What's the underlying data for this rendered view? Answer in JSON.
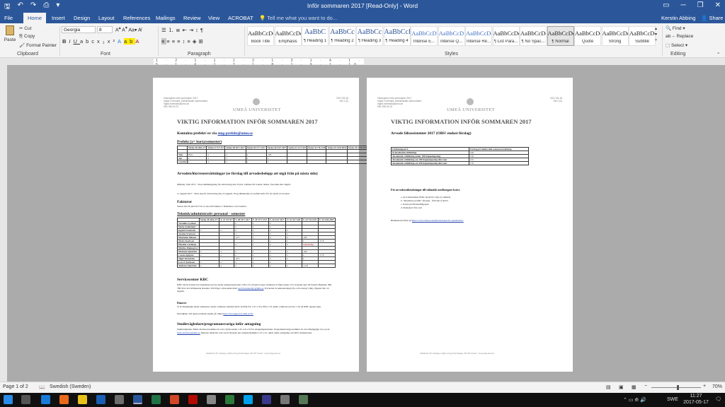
{
  "window": {
    "title": "Inför sommaren 2017 [Read-Only] - Word",
    "user": "Kerstin Abbing",
    "share": "Share"
  },
  "tabs": [
    "File",
    "Home",
    "Insert",
    "Design",
    "Layout",
    "References",
    "Mailings",
    "Review",
    "View",
    "ACROBAT"
  ],
  "tell_me": "Tell me what you want to do...",
  "clipboard": {
    "paste": "Paste",
    "cut": "Cut",
    "copy": "Copy",
    "format_painter": "Format Painter",
    "label": "Clipboard"
  },
  "font": {
    "name": "Georgia",
    "size": "8",
    "label": "Font"
  },
  "paragraph": {
    "label": "Paragraph"
  },
  "styles": {
    "label": "Styles",
    "items": [
      {
        "preview": "AaBbCcDd",
        "name": "Book Title"
      },
      {
        "preview": "AaBbCcDd",
        "name": "Emphasis"
      },
      {
        "preview": "AaBbC",
        "name": "¶ Heading 1"
      },
      {
        "preview": "AaBbCc",
        "name": "¶ Heading 2"
      },
      {
        "preview": "AaBbCc",
        "name": "¶ Heading 3"
      },
      {
        "preview": "AaBbCcD",
        "name": "¶ Heading 4"
      },
      {
        "preview": "AaBbCcD",
        "name": "Intense E..."
      },
      {
        "preview": "AaBbCcD",
        "name": "Intense Q..."
      },
      {
        "preview": "AaBbCcDd",
        "name": "Intense Re..."
      },
      {
        "preview": "AaBbCcDd",
        "name": "¶ List Para..."
      },
      {
        "preview": "AaBbCcDd",
        "name": "¶ No Spac..."
      },
      {
        "preview": "AaBbCcDd",
        "name": "¶ Normal"
      },
      {
        "preview": "AaBbCcDd",
        "name": "Quote"
      },
      {
        "preview": "AaBbCcDd",
        "name": "Strong"
      },
      {
        "preview": "AaBbCcDd",
        "name": "Subtitle"
      }
    ]
  },
  "editing": {
    "find": "Find",
    "replace": "Replace",
    "select": "Select",
    "label": "Editing"
  },
  "ruler_text": "1 · 2 · 1 · 1 · 1 · 2 · 1 · 3 · 1 · 4 · 1 · 5 · 1 · 6 · 1 · 7 · 1 · 8 · 1 · 9 · 1 · 10 · 1 · 11 · 1 · 12 · 1 · 13 · 1 · 14 · 1 · 15 · 1 · 16 · 17 · 18",
  "page1": {
    "hdr_left": "Information inför sommaren 2017\nIngrid Foremark, Administrativ samordnare\ningrid.foremark@umu.se\n090-786 63 22",
    "hdr_right": "2017-05-16\nSid 1 (2)",
    "uni": "UMEÅ UNIVERSITET",
    "title": "VIKTIG INFORMATION INFÖR SOMMAREN 2017",
    "contact": "Kontakta prefekt/-er via ",
    "contact_link": "emg-prefekt@umu.se",
    "prefekt_head": "Prefekt (x= borta/semester)",
    "prefekt_cols": [
      "",
      "Vecka 26 26/6-2/7",
      "Vecka 27 3/7-9/7",
      "Vecka 28 10/7-16/7",
      "Vecka 29 17/7-23/7",
      "Vecka 30 24/7-30/7",
      "Vecka 31 31/7-6/8",
      "Vecka 32 7/8-13/8",
      "Vecka 33 14/8-20/8",
      "Vecka 34 21/8-27/8",
      "Ytterligare ledighet"
    ],
    "prefekt_rows": [
      [
        "",
        "",
        "",
        "",
        "",
        "",
        "",
        "",
        "",
        "",
        "Vecka 23 lagförd"
      ],
      [
        "Tom",
        "29.6-",
        "x",
        "x",
        "x",
        "-4.8",
        "",
        "",
        "",
        "",
        "Vecka 25 lagförd"
      ],
      [
        "Jon",
        "x",
        "x",
        "x",
        "x",
        "x",
        "",
        "",
        "",
        "",
        "Vecka 35 lagförd"
      ],
      [
        "Carolin",
        "x",
        "x",
        "x",
        "x",
        "x",
        "",
        "",
        "",
        "",
        ""
      ]
    ],
    "arv_head": "Arvoden/lön/reseersättningar (se förslag till arvodesbelopp att utgå från på nästa sida)",
    "arv_p1": "Måndag 3 juli 2017 - Sista inlämningsdag för rubricering den 25 juli. Lämnas till Joanna, Marie, Veronika eller Ingrid.",
    "arv_p2": "11 augusti 2017 - Sista dag för rubricering den 25 augusti. Ett godkännande av prefekt krävs för att betala ut arvoden.",
    "fakt_head": "Fakturor",
    "fakt_p": "Senast den 30 juni 2017 kl 12 ska alla fakturor i Raindance vara betalda.",
    "tek_head": "Teknisk/administrativ personal - semester",
    "tek_cols": [
      "",
      "Vecka 26 26/6-2/7",
      "V. 27 3/7-9/7",
      "V. 28 10/7-16/7",
      "V. 29 17/7-23/7",
      "V. 30 24/7-30/7",
      "V. 31 31/7-6/8",
      "V. 32 7/8-13/8",
      "V. 33 14/8-20/8"
    ],
    "tek_rows": [
      [
        "Veronika Lyskaer",
        "",
        "",
        "x",
        "x",
        "x",
        "",
        "",
        ""
      ],
      [
        "Marie Söderlund",
        "",
        "",
        "x",
        "x",
        "x",
        "",
        "",
        ""
      ],
      [
        "Ingrid Foremark",
        "x",
        "x",
        "x",
        "x",
        "x",
        "x",
        "",
        ""
      ],
      [
        "Joanna Svensson",
        "",
        "",
        "x",
        "x",
        "x",
        "x",
        "",
        ""
      ],
      [
        "Marianne Nilsson",
        "",
        "",
        "12.7-",
        "x",
        "x",
        "x",
        "-4.8",
        ""
      ],
      [
        "Maria Karlsson",
        "",
        "",
        "",
        "x",
        "x",
        "x",
        "x",
        "-15.8"
      ],
      [
        "Elisabet Carlberg",
        "",
        "",
        "x",
        "x",
        "x",
        "x",
        "Tjänstledig",
        ""
      ],
      [
        "Märtha Malmqvist",
        "",
        "",
        "",
        "",
        "",
        "",
        "",
        ""
      ],
      [
        "Mariana Sjöström",
        "x",
        "x",
        "x",
        "x",
        "x",
        "x",
        "-4.8",
        ""
      ],
      [
        "Carola Sjögren",
        "x",
        "x",
        "x",
        "x",
        "x",
        "x",
        "x",
        "-17.8"
      ],
      [
        "Tegel Jernström",
        "",
        "",
        "10.7-",
        "x",
        "x",
        "x",
        "x",
        ""
      ],
      [
        "Lars E Karlsson",
        "x",
        "x",
        "x",
        "x",
        "x",
        "",
        "",
        ""
      ],
      [
        "Andreas Sjöström",
        "x",
        "x",
        "x",
        "x",
        "x",
        "x",
        "-11.8",
        ""
      ]
    ],
    "kbc_head": "Servicecenter KBC",
    "kbc_p": "KBC-Servicecenter har begränsad service under semesterperioden v.28-v.31 (10 juli-6 aug). Ordinarie öl finns under v.25. Kontakt sker till Sandra Hedlund, 090-786 5614 vid brådskande ärenden. Vid frågor om kontakt mail:",
    "kbc_link": "servicecenter.kbc@umu.se",
    "kbc_p2": "Tryckeriet är semesterstängt (Ss och torsdag 5 juli). Öppnar åter 14 augusti.",
    "dat_head": "Datorer",
    "dat_p": "Vi är tillgängliga under semestern, under ordinarie arbetstid (kl 8-16 mån-fre, v.27-v.31). Efter v.31 gäller ordinarie service, v.32 på KBC öppnar igen.",
    "dat_p2": "Datorhjälp: Vid akuta problem ansökt på vilken",
    "dat_link": "http://dat-support.at.umu.se/IT/",
    "stud_head": "Studievägledare/programansvariga inför antagning",
    "stud_p": "Studievägledare Marie Karlsson kommer att vara i tjänst under v.32 och v.33 för antagningsärenden. Programansvariga kommer att vara tillgängliga via e-post:",
    "stud_link": "marie.karlsson@umu.se",
    "stud_p2": "Mariana Sjöström och Carola Sjögren har semesterledighet v.27-v.31, tjänst under antagning och inför studiestarten.",
    "footer": "Studenter för ekologi, miljö och geovetenskap, 901 87 Umeå · www.emg.umu.se"
  },
  "page2": {
    "hdr_left": "Information inför sommaren 2017\nIngrid Foremark, Administrativ samordnare\ningrid.foremark@umu.se\n090-786 63 22",
    "hdr_right": "2017-05-16\nSid 2 (2)",
    "uni": "UMEÅ UNIVERSITET",
    "title": "VIKTIG INFORMATION INFÖR SOMMAREN 2017",
    "arv_head": "Arvode fältassistenter 2017 (OBS! endast förslag)",
    "table_head": [
      "Utbildningsnivå",
      "Förslag på timlön inkl semesterersättning"
    ],
    "table_rows": [
      [
        "0) akademisk utbildning",
        "140"
      ],
      [
        "Akademisk utbildning under 180 högskolepoäng",
        "150"
      ],
      [
        "Akademisk utbildning om 180 högskolepoäng eller mer",
        "155"
      ],
      [
        "Akademisk utbildning om 300 högskolepoäng eller mer",
        "170"
      ]
    ],
    "list_head": "För arvodesutbetalningar till utländsk medborgare krävs",
    "list_items": [
      "a. Arvodesblankett (ERC Kynd för varje ny månad)",
      "b. \"Residence permit\" (Kopia) - ifall den så krävs",
      "c. Kopia på ID-handling/pass",
      "d. Skattekort/Tax card"
    ],
    "blank_pre": "Blanketterna finns på ",
    "blank_link": "https://www.umu.se/student/ansokan/for-nyinskrivna/",
    "footer": "Studenter för ekologi, miljö och geovetenskap, 901 87 Umeå · www.emg.umu.se"
  },
  "status": {
    "page": "Page 1 of 2",
    "language": "Swedish (Sweden)",
    "zoom": "70%"
  },
  "taskbar": {
    "lang": "SWE",
    "time": "11:27",
    "date": "2017-05-17"
  },
  "colors": {
    "word_blue": "#2b579a",
    "ribbon_bg": "#f3f3f3",
    "doc_bg": "#ababab"
  }
}
